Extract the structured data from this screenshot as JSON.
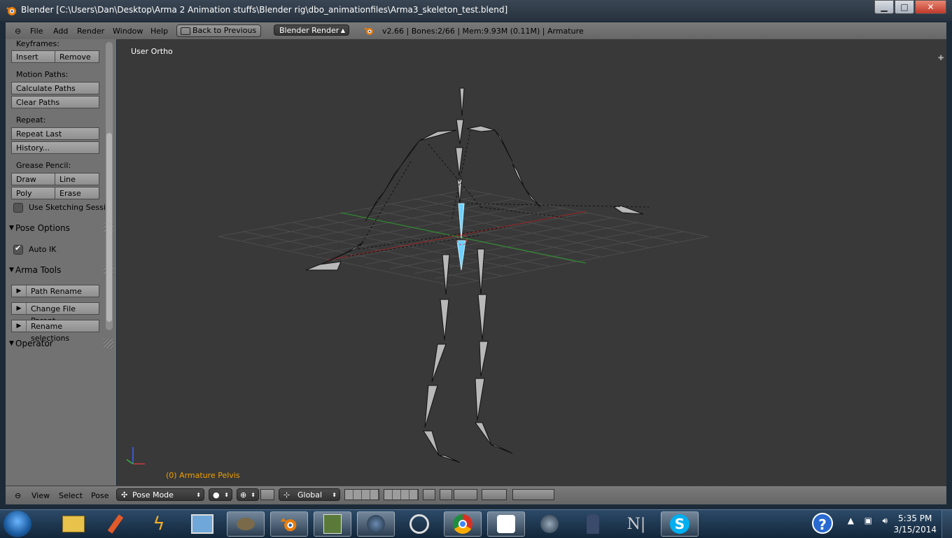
{
  "window": {
    "title": "Blender [C:\\Users\\Dan\\Desktop\\Arma 2 Animation stuffs\\Blender rig\\dbo_animationfiles\\Arma3_skeleton_test.blend]",
    "minimize": "▁",
    "maximize": "□",
    "close": "✕"
  },
  "header": {
    "menus": [
      "File",
      "Add",
      "Render",
      "Window",
      "Help"
    ],
    "back_label": "Back to Previous",
    "render_engine": "Blender Render",
    "stats": "v2.66 | Bones:2/66 | Mem:9.93M (0.11M) | Armature"
  },
  "toolshelf": {
    "keyframes_label": "Keyframes:",
    "insert": "Insert",
    "remove": "Remove",
    "motion_paths_label": "Motion Paths:",
    "calculate_paths": "Calculate Paths",
    "clear_paths": "Clear Paths",
    "repeat_label": "Repeat:",
    "repeat_last": "Repeat Last",
    "history": "History...",
    "grease_pencil_label": "Grease Pencil:",
    "draw": "Draw",
    "line": "Line",
    "poly": "Poly",
    "erase": "Erase",
    "use_sketching": "Use Sketching Sessi",
    "pose_options_title": "Pose Options",
    "auto_ik": "Auto IK",
    "arma_tools_title": "Arma Tools",
    "path_rename": "Path Rename",
    "change_file_parent": "Change File Parent",
    "rename_selections": "Rename selections",
    "operator_title": "Operator"
  },
  "viewport": {
    "view_name": "User Ortho",
    "status": "(0) Armature Pelvis"
  },
  "bottombar": {
    "menus": [
      "View",
      "Select",
      "Pose"
    ],
    "mode": "Pose Mode",
    "orientation": "Global"
  },
  "taskbar": {
    "time": "5:35 PM",
    "date": "3/15/2014",
    "apps": [
      "explorer-icon",
      "pencil-icon",
      "lightning-icon",
      "image-viewer-icon",
      "gimp-icon",
      "blender-icon",
      "game-tool-icon",
      "headset-icon",
      "network-icon",
      "chrome-icon",
      "chat-icon",
      "headphones-icon",
      "soldier-icon",
      "ni-mate-icon",
      "skype-icon"
    ]
  },
  "colors": {
    "status_text": "#f0a000",
    "selected_bone": "#6fd0ff",
    "x_axis": "#c83c3c",
    "y_axis": "#3cb43c",
    "z_axis": "#3c64ff"
  }
}
